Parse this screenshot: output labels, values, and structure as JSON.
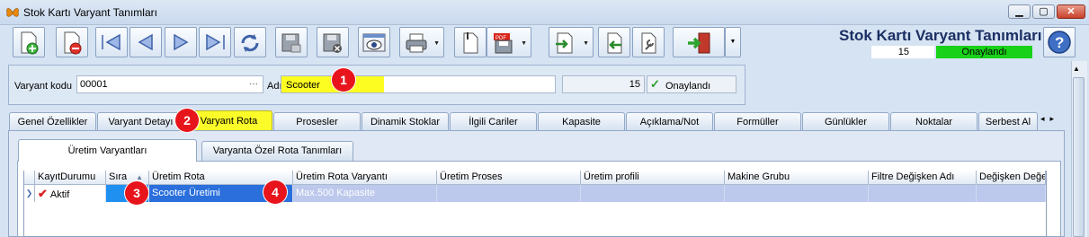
{
  "window": {
    "title": "Stok Kartı Varyant Tanımları",
    "app_icon": "butterfly-icon"
  },
  "toolbar": {
    "buttons": [
      "new-icon",
      "delete-icon",
      "first-icon",
      "prev-icon",
      "next-icon",
      "last-icon",
      "refresh-icon",
      "save-icon",
      "cancel-save-icon",
      "preview-icon",
      "print-icon",
      "copy-icon",
      "pdf-export-icon",
      "import-icon",
      "back-icon",
      "tools-icon",
      "exit-icon"
    ]
  },
  "header": {
    "title": "Stok Kartı Varyant Tanımları",
    "count": "15",
    "status": "Onaylandı",
    "status_color": "#18d118"
  },
  "form": {
    "code_label": "Varyant kodu",
    "code_value": "00001",
    "code_ellipsis": "···",
    "name_label": "Adı",
    "name_value": "Scooter",
    "number": "15",
    "approved_label": "Onaylandı",
    "highlight_color": "#fdfd22"
  },
  "tabs": [
    "Genel Özellikler",
    "Varyant Detayı",
    "Varyant Rota",
    "Prosesler",
    "Dinamik Stoklar",
    "İlgili Cariler",
    "Kapasite",
    "Açıklama/Not",
    "Formüller",
    "Günlükler",
    "Noktalar",
    "Serbest Al"
  ],
  "subtabs": [
    "Üretim Varyantları",
    "Varyanta Özel Rota Tanımları"
  ],
  "grid": {
    "columns": [
      "KayıtDurumu",
      "Sıra",
      "Üretim Rota",
      "Üretim Rota Varyantı",
      "Üretim Proses",
      "Üretim profili",
      "Makine Grubu",
      "Filtre Değişken Adı",
      "Değişken Değer"
    ],
    "row": {
      "kayit": "Aktif",
      "sira": "",
      "rota": "Scooter Üretimi",
      "rota_varyanti": "Max.500  Kapasite",
      "proses": "",
      "profil": "",
      "makine": "",
      "filtre": "",
      "deger": ""
    }
  },
  "markers": [
    "1",
    "2",
    "3",
    "4"
  ],
  "marker_color": "#e8141c"
}
